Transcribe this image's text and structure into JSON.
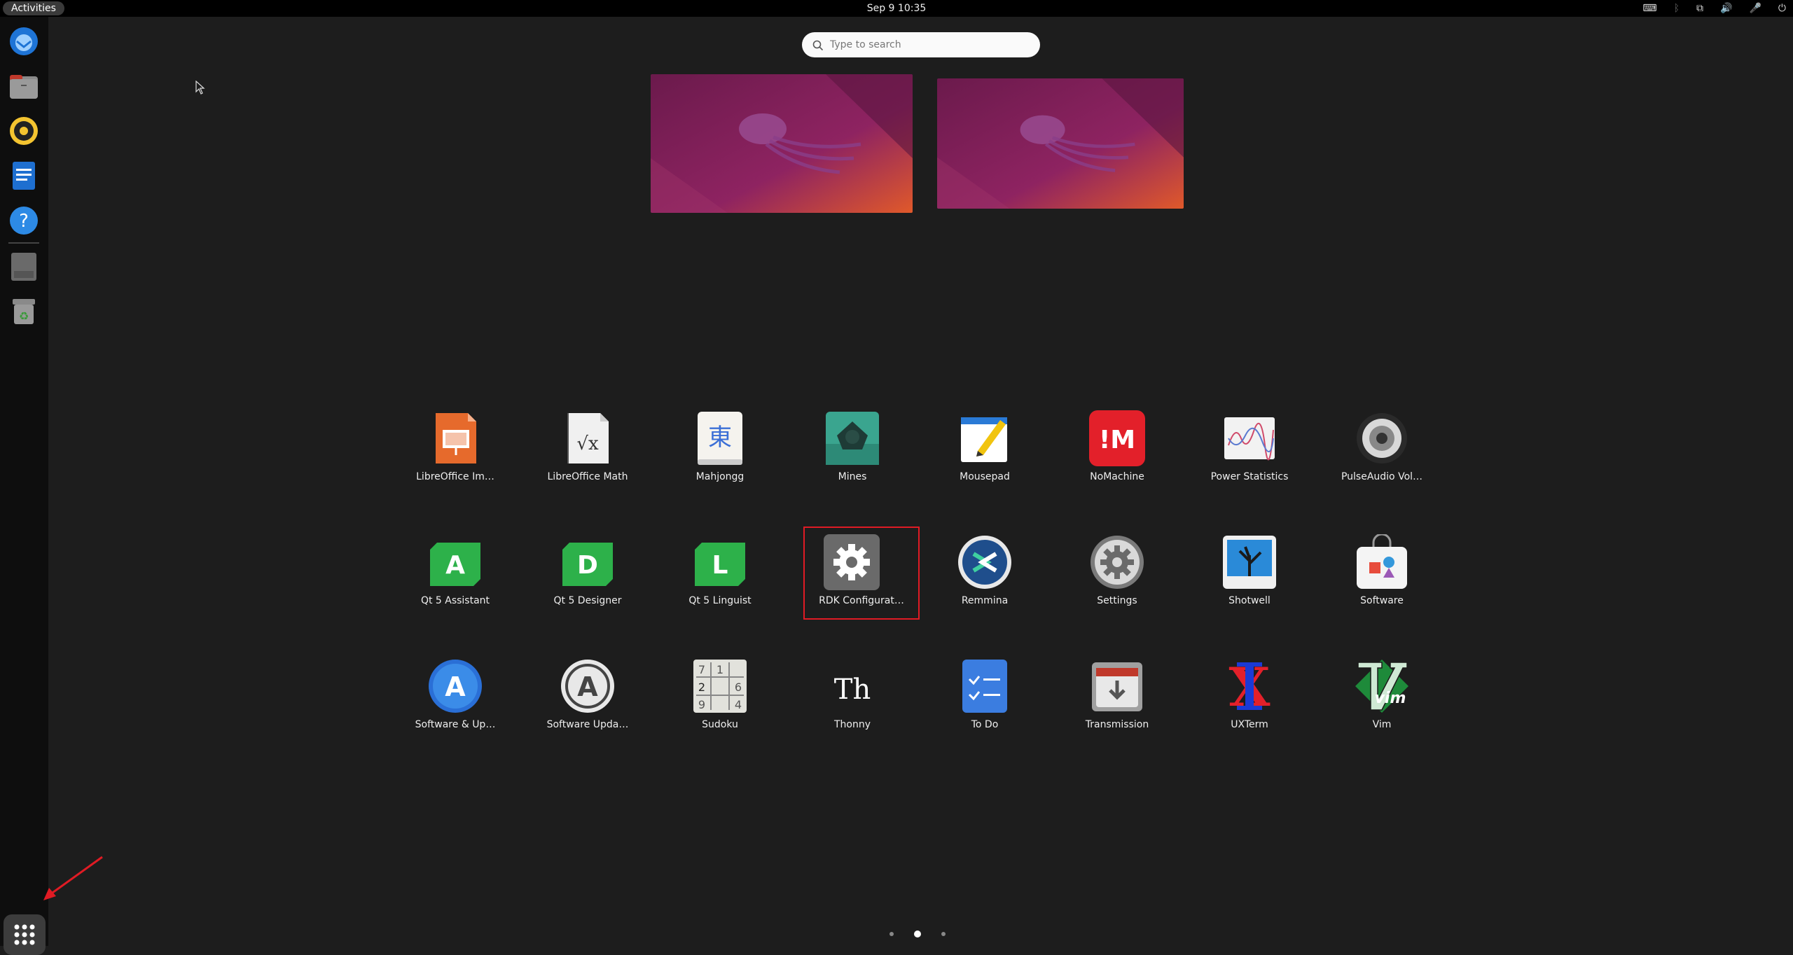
{
  "topbar": {
    "activities": "Activities",
    "clock": "Sep 9  10:35"
  },
  "search": {
    "placeholder": "Type to search"
  },
  "dock": {
    "items": [
      "thunderbird-icon",
      "files-icon",
      "rhythmbox-icon",
      "writer-icon",
      "help-icon",
      "disk-icon",
      "trash-icon"
    ],
    "apps_button": "show-apps-icon"
  },
  "apps": [
    {
      "label": "LibreOffice Im…",
      "icon": "impress-icon"
    },
    {
      "label": "LibreOffice Math",
      "icon": "math-icon"
    },
    {
      "label": "Mahjongg",
      "icon": "mahjongg-icon",
      "glyph": "東"
    },
    {
      "label": "Mines",
      "icon": "mines-icon"
    },
    {
      "label": "Mousepad",
      "icon": "mousepad-icon"
    },
    {
      "label": "NoMachine",
      "icon": "nomachine-icon",
      "glyph": "!M"
    },
    {
      "label": "Power Statistics",
      "icon": "power-statistics-icon"
    },
    {
      "label": "PulseAudio Vol…",
      "icon": "pulseaudio-icon"
    },
    {
      "label": "Qt 5 Assistant",
      "icon": "qt-assistant-icon",
      "glyph": "A"
    },
    {
      "label": "Qt 5 Designer",
      "icon": "qt-designer-icon",
      "glyph": "D"
    },
    {
      "label": "Qt 5 Linguist",
      "icon": "qt-linguist-icon",
      "glyph": "L"
    },
    {
      "label": "RDK Configurat…",
      "icon": "gear-icon",
      "selected": true
    },
    {
      "label": "Remmina",
      "icon": "remmina-icon"
    },
    {
      "label": "Settings",
      "icon": "settings-icon"
    },
    {
      "label": "Shotwell",
      "icon": "shotwell-icon"
    },
    {
      "label": "Software",
      "icon": "software-icon"
    },
    {
      "label": "Software & Up…",
      "icon": "software-updates-icon",
      "glyph": "A"
    },
    {
      "label": "Software Upda…",
      "icon": "software-updater-icon",
      "glyph": "A"
    },
    {
      "label": "Sudoku",
      "icon": "sudoku-icon"
    },
    {
      "label": "Thonny",
      "icon": "thonny-icon",
      "glyph": "Th"
    },
    {
      "label": "To Do",
      "icon": "todo-icon"
    },
    {
      "label": "Transmission",
      "icon": "transmission-icon"
    },
    {
      "label": "UXTerm",
      "icon": "uxterm-icon",
      "glyph": "X"
    },
    {
      "label": "Vim",
      "icon": "vim-icon",
      "glyph": "vim"
    }
  ],
  "sudoku_digits": [
    "7",
    "1",
    "",
    "2",
    "",
    "6",
    "9",
    "",
    "4"
  ],
  "pages": {
    "count": 3,
    "current": 2
  },
  "colors": {
    "accent": "#e01b24",
    "workspace": "#8a1f5a"
  }
}
